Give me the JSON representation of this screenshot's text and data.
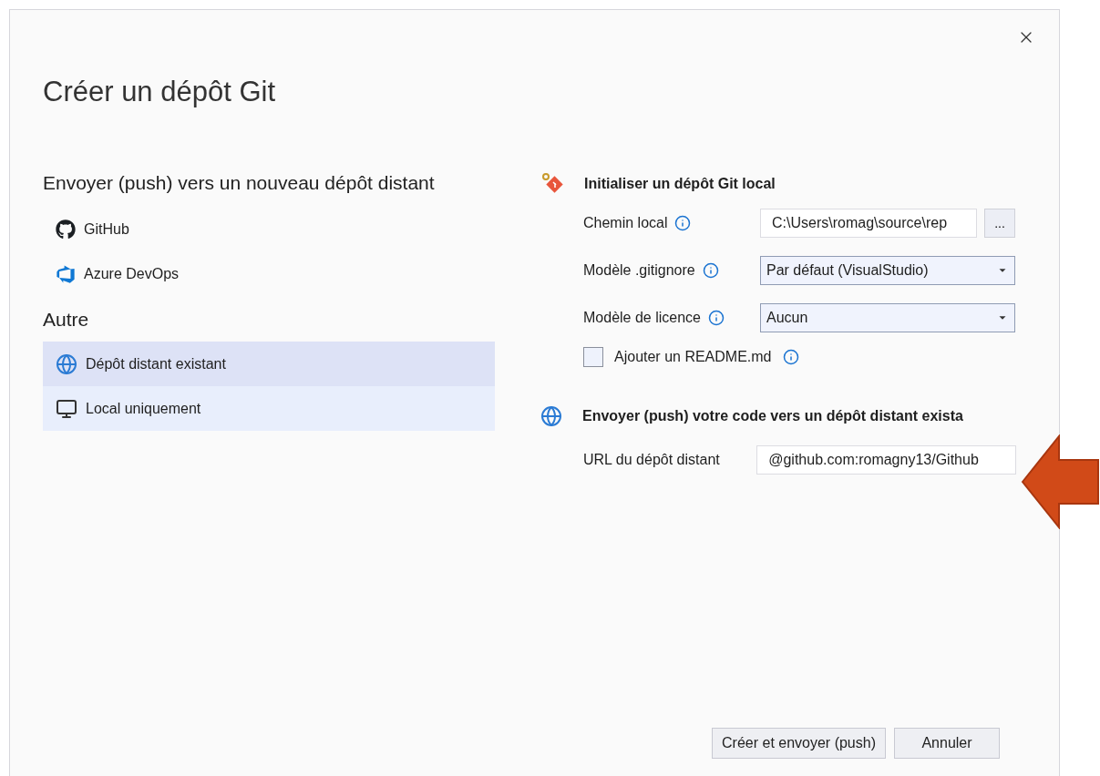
{
  "dialog": {
    "title": "Créer un dépôt Git"
  },
  "push_new": {
    "heading": "Envoyer (push) vers un nouveau dépôt distant",
    "items": [
      {
        "kind": "github",
        "label": "GitHub",
        "selected": false,
        "hovered": false
      },
      {
        "kind": "azure",
        "label": "Azure DevOps",
        "selected": false,
        "hovered": false
      }
    ]
  },
  "other": {
    "heading": "Autre",
    "items": [
      {
        "kind": "remote",
        "label": "Dépôt distant existant",
        "selected": true,
        "hovered": false
      },
      {
        "kind": "local",
        "label": "Local uniquement",
        "selected": false,
        "hovered": true
      }
    ]
  },
  "init_local": {
    "heading": "Initialiser un dépôt Git local",
    "fields": [
      {
        "kind": "path",
        "label": "Chemin local",
        "value": "C:\\Users\\romag\\source\\rep",
        "browse": "..."
      },
      {
        "kind": "dropdown",
        "label": "Modèle .gitignore",
        "value": "Par défaut (VisualStudio)"
      },
      {
        "kind": "dropdown",
        "label": "Modèle de licence",
        "value": "Aucun"
      }
    ],
    "readme": {
      "label": "Ajouter un README.md",
      "checked": false
    }
  },
  "push_existing": {
    "heading": "Envoyer (push) votre code vers un dépôt distant exista",
    "url": {
      "label": "URL du dépôt distant",
      "value": "@github.com:romagny13/Github"
    }
  },
  "buttons": [
    "Créer et envoyer (push)",
    "Annuler"
  ]
}
